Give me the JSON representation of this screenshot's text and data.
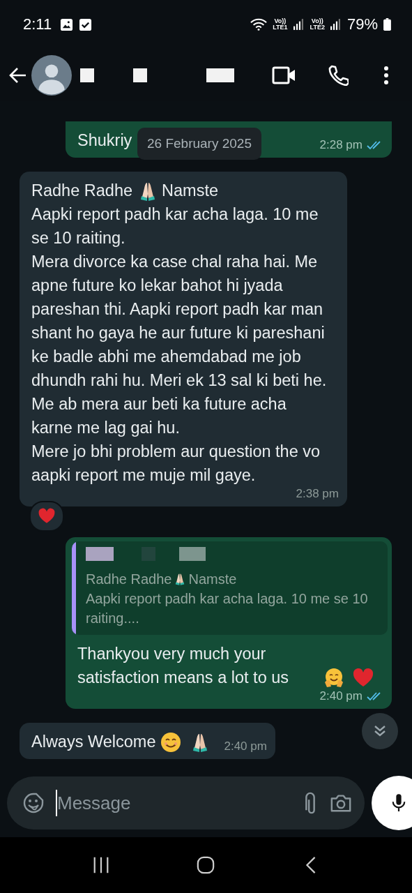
{
  "status_bar": {
    "time": "2:11",
    "network": [
      {
        "top": "Vo))",
        "bottom": "LTE1"
      },
      {
        "top": "Vo))",
        "bottom": "LTE2"
      }
    ],
    "battery": "79%"
  },
  "date_chip": "26 February 2025",
  "messages": [
    {
      "kind": "sent",
      "paragraphs": [
        [
          {
            "kind": "text",
            "text": "Shukriy"
          }
        ]
      ],
      "time": "2:28 pm",
      "read": true
    },
    {
      "kind": "received",
      "paragraphs": [
        [
          {
            "kind": "text",
            "text": "Radhe Radhe"
          },
          {
            "kind": "pray"
          },
          {
            "kind": "text",
            "text": "Namste"
          }
        ],
        [
          {
            "kind": "text",
            "text": "Aapki report padh kar acha laga. 10 me se 10 raiting."
          }
        ],
        [
          {
            "kind": "text",
            "text": "Mera divorce ka case chal raha hai. Me apne future ko lekar bahot hi jyada pareshan thi. Aapki report padh kar man shant ho gaya he aur future ki pareshani ke badle abhi me ahemdabad me job dhundh rahi hu. Meri ek 13 sal ki beti he. Me ab mera aur beti ka future acha karne me lag gai hu."
          }
        ],
        [
          {
            "kind": "text",
            "text": "Mere jo bhi problem aur question the vo aapki report me muje mil gaye."
          }
        ]
      ],
      "time": "2:38 pm",
      "reaction": {
        "kind": "heart"
      }
    },
    {
      "kind": "sent",
      "quote": {
        "paragraphs": [
          [
            {
              "kind": "text",
              "text": "Radhe Radhe"
            },
            {
              "kind": "pray"
            },
            {
              "kind": "text",
              "text": "Namste"
            }
          ],
          [
            {
              "kind": "text",
              "text": "Aapki report padh kar acha laga. 10 me se 10 raiting...."
            }
          ]
        ]
      },
      "paragraphs": [
        [
          {
            "kind": "text",
            "text": "Thankyou very much your satisfaction means a lot to us"
          },
          {
            "kind": "hug"
          },
          {
            "kind": "heart"
          }
        ]
      ],
      "time": "2:40 pm",
      "read": true
    },
    {
      "kind": "received",
      "paragraphs": [
        [
          {
            "kind": "text",
            "text": "Always Welcome"
          },
          {
            "kind": "smile"
          },
          {
            "kind": "pray"
          }
        ]
      ],
      "time": "2:40 pm"
    }
  ],
  "composer": {
    "placeholder": "Message"
  }
}
